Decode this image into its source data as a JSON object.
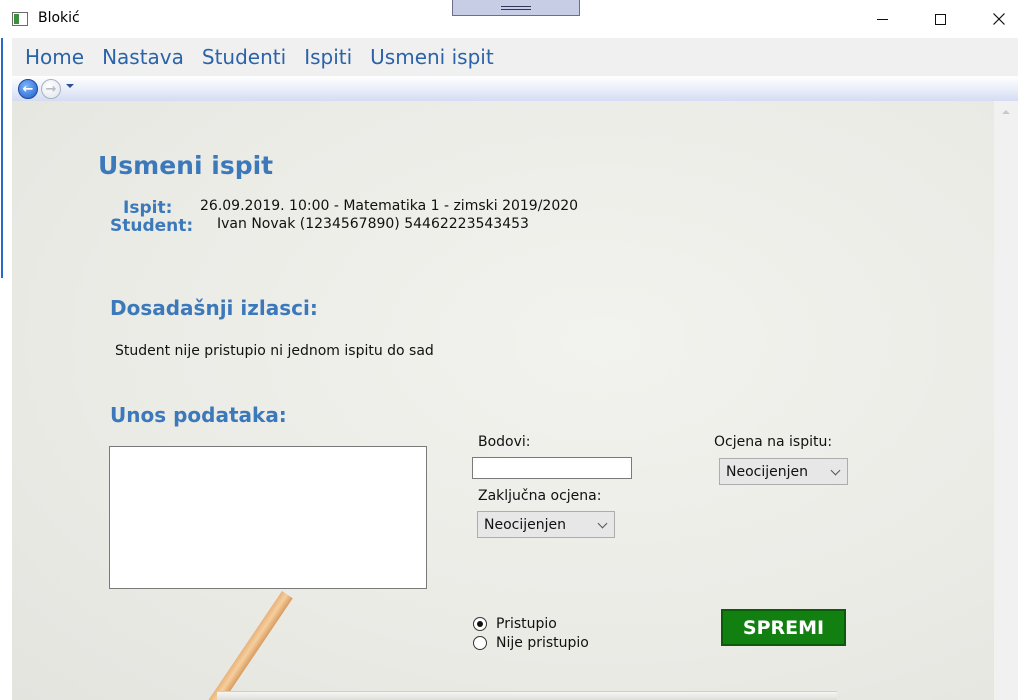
{
  "window": {
    "title": "Blokić"
  },
  "menu": {
    "items": [
      "Home",
      "Nastava",
      "Studenti",
      "Ispiti",
      "Usmeni ispit"
    ]
  },
  "page": {
    "title": "Usmeni ispit",
    "ispit_label": "Ispit:",
    "ispit_value": "26.09.2019. 10:00 - Matematika 1 - zimski 2019/2020",
    "student_label": "Student:",
    "student_value": "Ivan Novak (1234567890) 54462223543453",
    "previous_heading": "Dosadašnji izlasci:",
    "previous_text": "Student nije pristupio ni jednom ispitu do sad",
    "entry_heading": "Unos podataka:"
  },
  "form": {
    "notes_value": "",
    "bodovi_label": "Bodovi:",
    "bodovi_value": "",
    "zakljucna_label": "Zaključna ocjena:",
    "zakljucna_selected": "Neocijenjen",
    "ocjena_label": "Ocjena na ispitu:",
    "ocjena_selected": "Neocijenjen",
    "radio_pristupio": "Pristupio",
    "radio_nije": "Nije pristupio",
    "radio_selected": "Pristupio",
    "save_label": "SPREMI"
  },
  "colors": {
    "accent": "#3c79bb",
    "save_button": "#118011"
  }
}
